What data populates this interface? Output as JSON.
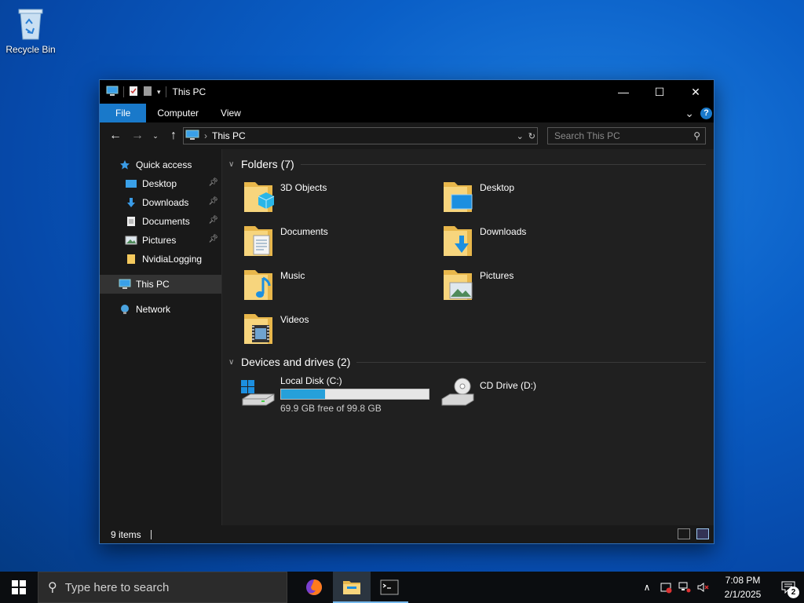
{
  "desktop": {
    "icons": [
      {
        "label": "Recycle Bin",
        "icon": "recycle-bin-icon"
      }
    ]
  },
  "window": {
    "title": "This PC",
    "controls": {
      "minimize": "—",
      "maximize": "☐",
      "close": "✕"
    }
  },
  "ribbon": {
    "tabs": [
      {
        "label": "File",
        "active": true
      },
      {
        "label": "Computer"
      },
      {
        "label": "View"
      }
    ],
    "help": "?",
    "expand": "⌄"
  },
  "address": {
    "back": "←",
    "forward": "→",
    "recent": "⌄",
    "up": "↑",
    "crumbs": [
      "This PC"
    ],
    "search_placeholder": "Search This PC"
  },
  "navpane": {
    "quick_access": "Quick access",
    "pinned": [
      {
        "label": "Desktop",
        "icon": "desktop-folder-icon",
        "pinned": true
      },
      {
        "label": "Downloads",
        "icon": "downloads-icon",
        "pinned": true
      },
      {
        "label": "Documents",
        "icon": "documents-icon",
        "pinned": true
      },
      {
        "label": "Pictures",
        "icon": "pictures-icon",
        "pinned": true
      },
      {
        "label": "NvidiaLogging",
        "icon": "folder-icon",
        "pinned": false
      }
    ],
    "this_pc": "This PC",
    "network": "Network"
  },
  "content": {
    "folders_header": "Folders (7)",
    "folders": [
      {
        "name": "3D Objects",
        "icon": "3d-objects-icon"
      },
      {
        "name": "Desktop",
        "icon": "desktop-folder-icon"
      },
      {
        "name": "Documents",
        "icon": "documents-icon"
      },
      {
        "name": "Downloads",
        "icon": "downloads-icon"
      },
      {
        "name": "Music",
        "icon": "music-icon"
      },
      {
        "name": "Pictures",
        "icon": "pictures-icon"
      },
      {
        "name": "Videos",
        "icon": "videos-icon"
      }
    ],
    "drives_header": "Devices and drives (2)",
    "drives": [
      {
        "name": "Local Disk (C:)",
        "free_text": "69.9 GB free of 99.8 GB",
        "used_fraction": 0.3,
        "icon": "local-disk-icon"
      },
      {
        "name": "CD Drive (D:)",
        "icon": "cd-drive-icon"
      }
    ]
  },
  "statusbar": {
    "items": "9 items"
  },
  "taskbar": {
    "search_placeholder": "Type here to search",
    "apps": [
      {
        "name": "firefox",
        "icon": "firefox-icon",
        "active": false
      },
      {
        "name": "file-explorer",
        "icon": "file-explorer-icon",
        "active": true
      },
      {
        "name": "terminal",
        "icon": "terminal-icon",
        "active": false
      }
    ],
    "time": "7:08 PM",
    "date": "2/1/2025",
    "notification_count": "2"
  },
  "colors": {
    "accent": "#1979ca",
    "drive_bar": "#26a0da",
    "window_bg": "#191919"
  }
}
